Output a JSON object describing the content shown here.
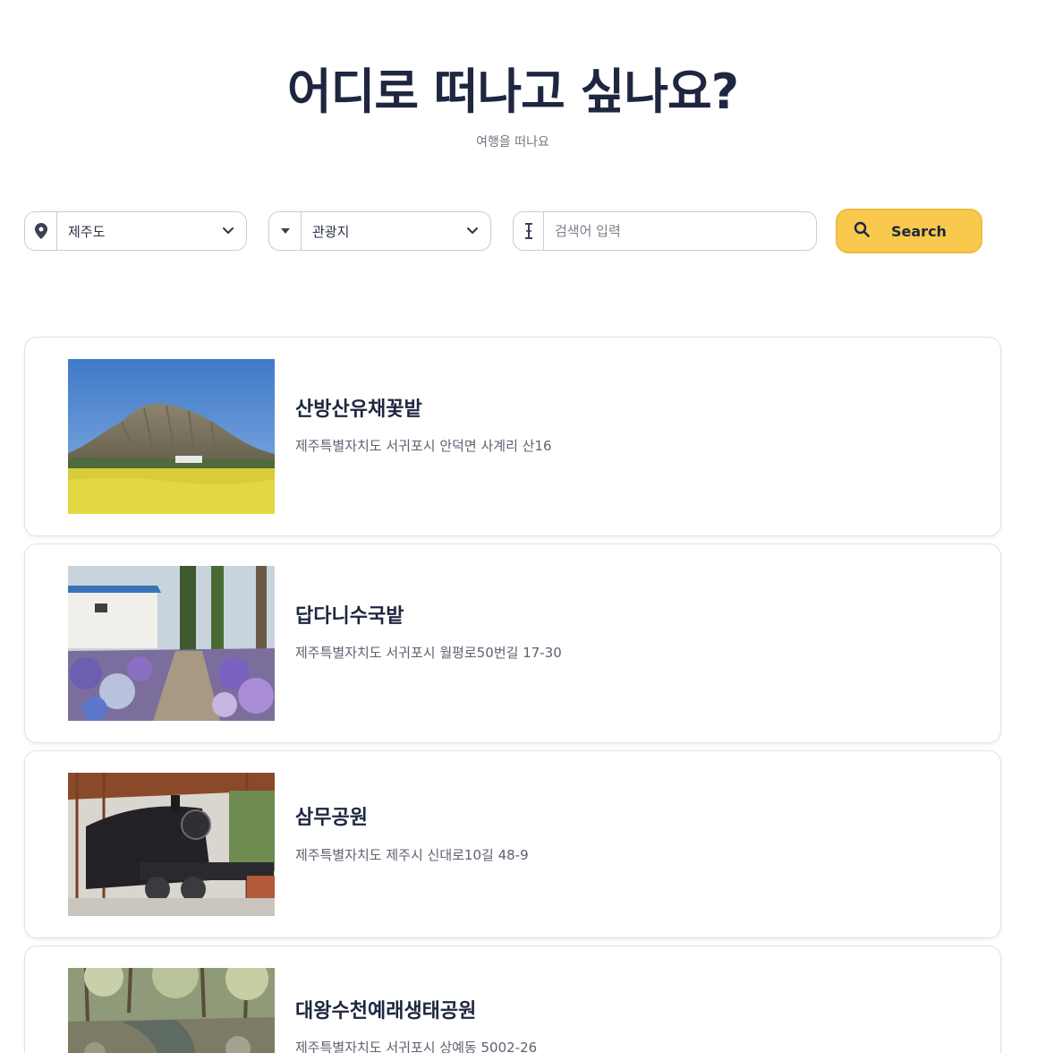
{
  "header": {
    "title": "어디로 떠나고 싶나요?",
    "subtitle": "여행을 떠나요"
  },
  "filters": {
    "region": {
      "icon": "map-pin-icon",
      "selected": "제주도"
    },
    "category": {
      "icon": "caret-down-icon",
      "selected": "관광지"
    },
    "keyword": {
      "icon": "text-cursor-icon",
      "placeholder": "검색어 입력",
      "value": ""
    },
    "search_label": "Search",
    "search_icon": "search-icon"
  },
  "results": [
    {
      "title": "산방산유채꽃밭",
      "address": "제주특별자치도 서귀포시 안덕면 사계리 산16",
      "image": "mountain-rapeseed-field-photo"
    },
    {
      "title": "답다니수국밭",
      "address": "제주특별자치도 서귀포시 월평로50번길 17-30",
      "image": "hydrangea-garden-photo"
    },
    {
      "title": "삼무공원",
      "address": "제주특별자치도 제주시 신대로10길 48-9",
      "image": "steam-locomotive-photo"
    },
    {
      "title": "대왕수천예래생태공원",
      "address": "제주특별자치도 서귀포시 상예동 5002-26",
      "image": "stream-park-photo"
    }
  ],
  "colors": {
    "title": "#1e2640",
    "accent": "#f8c94d",
    "border": "#c9ccd2"
  }
}
